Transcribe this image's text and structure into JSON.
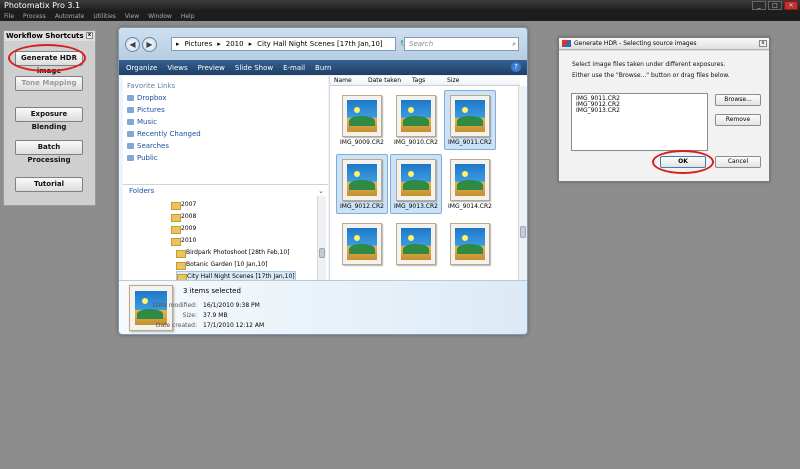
{
  "app": {
    "title": "Photomatix Pro 3.1"
  },
  "menu": [
    "File",
    "Process",
    "Automate",
    "Utilities",
    "View",
    "Window",
    "Help"
  ],
  "workflow": {
    "title": "Workflow Shortcuts",
    "buttons": [
      "Generate HDR image",
      "Tone Mapping",
      "Exposure Blending",
      "Batch Processing",
      "Tutorial"
    ],
    "disabled": [
      "Tone Mapping"
    ],
    "highlighted": "Generate HDR image"
  },
  "explorer": {
    "breadcrumb": [
      "Pictures",
      "2010",
      "City Hall Night Scenes [17th Jan,10]"
    ],
    "search_placeholder": "Search",
    "toolbar": [
      "Organize",
      "Views",
      "Preview",
      "Slide Show",
      "E-mail",
      "Burn"
    ],
    "favorite_links_header": "Favorite Links",
    "favorite_links": [
      "Dropbox",
      "Pictures",
      "Music",
      "Recently Changed",
      "Searches",
      "Public"
    ],
    "folders_header": "Folders",
    "folders": [
      "2007",
      "2008",
      "2009",
      "2010",
      "Birdpark Photoshoot [28th Feb,10]",
      "Botanic Garden [10 Jan,10]",
      "City Hall Night Scenes [17th Jan,10]"
    ],
    "selected_folder": "City Hall Night Scenes [17th Jan,10]",
    "columns": [
      "Name",
      "Date taken",
      "Tags",
      "Size"
    ],
    "files": [
      {
        "name": "IMG_9009.CR2",
        "selected": false
      },
      {
        "name": "IMG_9010.CR2",
        "selected": false
      },
      {
        "name": "IMG_9011.CR2",
        "selected": true
      },
      {
        "name": "IMG_9012.CR2",
        "selected": true
      },
      {
        "name": "IMG_9013.CR2",
        "selected": true
      },
      {
        "name": "IMG_9014.CR2",
        "selected": false
      },
      {
        "name": "",
        "selected": false
      },
      {
        "name": "",
        "selected": false
      },
      {
        "name": "",
        "selected": false
      }
    ],
    "details": {
      "count": "3 items selected",
      "date_modified_label": "Date modified:",
      "date_modified": "16/1/2010 9:38 PM",
      "size_label": "Size:",
      "size": "37.9 MB",
      "date_created_label": "Date created:",
      "date_created": "17/1/2010 12:12 AM"
    }
  },
  "hdr_dialog": {
    "title": "Generate HDR - Selecting source images",
    "line1": "Select image files taken under different exposures.",
    "line2": "Either use the \"Browse...\" button or drag files below.",
    "files": [
      "IMG_9011.CR2",
      "IMG_9012.CR2",
      "IMG_9013.CR2"
    ],
    "browse": "Browse...",
    "remove": "Remove",
    "ok": "OK",
    "cancel": "Cancel"
  },
  "colors": {
    "highlight_ring": "#d81e1e",
    "explorer_toolbar": "#2a4f7c"
  }
}
